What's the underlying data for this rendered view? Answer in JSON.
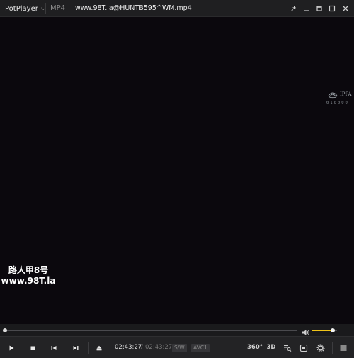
{
  "titlebar": {
    "app_name": "PotPlayer",
    "format": "MP4",
    "file_title": "www.98T.la@HUNTB595^WM.mp4"
  },
  "video": {
    "overlay_line1": "路人甲8号",
    "overlay_line2": "www.98T.la",
    "watermark_mark": "IPPA",
    "watermark_code": "010000"
  },
  "seek": {
    "position_fraction": 0.0,
    "volume_fraction": 0.82
  },
  "controls": {
    "current_time": "02:43:27",
    "separator": "/",
    "total_time": "02:43:27",
    "badge_sw": "S/W",
    "badge_codec": "AVC1",
    "btn_360": "360°",
    "btn_3d": "3D"
  },
  "colors": {
    "accent_volume": "#f0c419",
    "background": "#0b080d",
    "chrome": "#232325"
  },
  "icons": [
    "pin-icon",
    "minimize-icon",
    "maximize-icon",
    "fullscreen-icon",
    "close-icon",
    "play-icon",
    "stop-icon",
    "previous-icon",
    "next-icon",
    "eject-icon",
    "volume-icon",
    "playlist-search-icon",
    "capture-icon",
    "settings-icon",
    "menu-icon"
  ]
}
